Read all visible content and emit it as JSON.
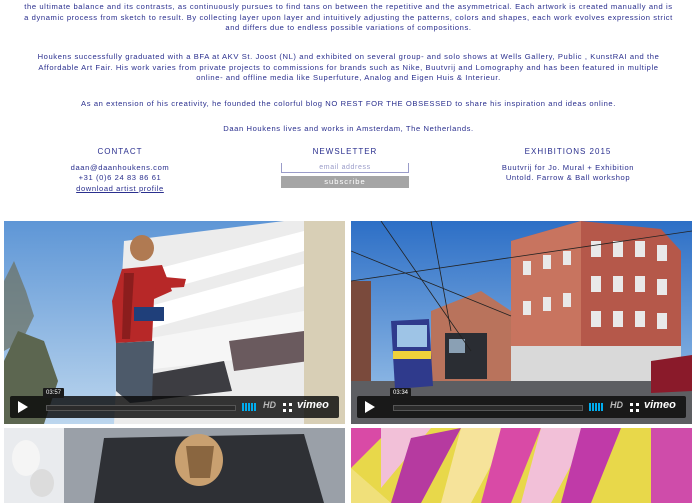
{
  "bio": {
    "p1_l1": "the ultimate balance and its contrasts, as continuously pursues to find tans on between the repetitive and the asymmetrical. Each artwork is created manually and is",
    "p1_l2": "a dynamic process from sketch to result. By collecting layer upon layer and intuitively adjusting the patterns, colors and shapes, each work evolves expression strict",
    "p1_l3": "and differs due to endless possible variations of compositions.",
    "p2_l1": "Houkens successfully graduated with a BFA at AKV St. Joost (NL) and exhibited on several group- and solo shows at Wells Gallery, Public , KunstRAI and the",
    "p2_l2": "Affordable Art Fair. His work varies from private projects to commissions for brands such as Nike, Buutvrij and Lomography and has been featured in multiple",
    "p2_l3": "online- and offline media like Superfuture, Analog and Eigen Huis & Interieur.",
    "p3": "As an extension of his creativity, he founded the colorful blog NO REST FOR THE OBSESSED to share his inspiration and ideas online.",
    "p4": "Daan Houkens lives and works in Amsterdam, The Netherlands."
  },
  "contact": {
    "heading": "CONTACT",
    "email": "daan@daanhoukens.com",
    "phone": "+31 (0)6 24 83 86 61",
    "download": "download artist profile"
  },
  "newsletter": {
    "heading": "NEWSLETTER",
    "placeholder": "email address",
    "button": "subscribe"
  },
  "exhibitions": {
    "heading": "EXHIBITIONS 2015",
    "item1": "Buutvrij for Jo. Mural + Exhibition",
    "item2": "Untold. Farrow & Ball workshop"
  },
  "videos": [
    {
      "time": "03:57",
      "hd": "HD",
      "brand": "vimeo"
    },
    {
      "time": "03:34",
      "hd": "HD",
      "brand": "vimeo"
    }
  ],
  "colors": {
    "text": "#2a2f8e",
    "button": "#a5a5a5",
    "vimeo_accent": "#00adef"
  }
}
